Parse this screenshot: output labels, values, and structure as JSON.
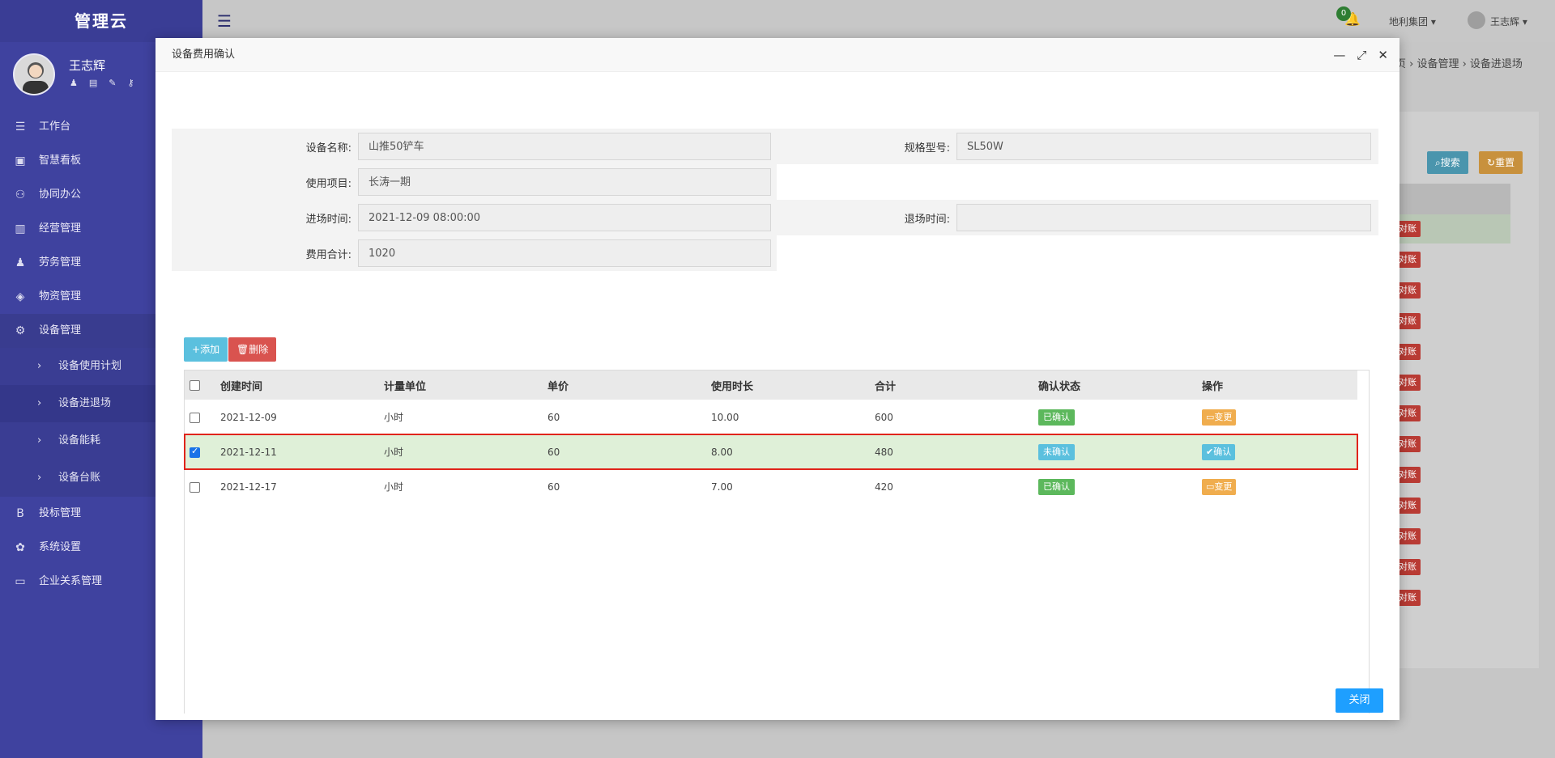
{
  "sidebar": {
    "brand": "管理云",
    "user_name": "王志辉",
    "menu": [
      {
        "label": "工作台",
        "icon": "☰"
      },
      {
        "label": "智慧看板",
        "icon": "▣"
      },
      {
        "label": "协同办公",
        "icon": "⚇"
      },
      {
        "label": "经营管理",
        "icon": "▥"
      },
      {
        "label": "劳务管理",
        "icon": "♟"
      },
      {
        "label": "物资管理",
        "icon": "◈"
      },
      {
        "label": "设备管理",
        "icon": "⚙"
      }
    ],
    "sub_menu": [
      {
        "label": "设备使用计划"
      },
      {
        "label": "设备进退场"
      },
      {
        "label": "设备能耗"
      },
      {
        "label": "设备台账"
      }
    ],
    "menu_after": [
      {
        "label": "投标管理",
        "icon": "B"
      },
      {
        "label": "系统设置",
        "icon": "✿"
      },
      {
        "label": "企业关系管理",
        "icon": "▭"
      }
    ]
  },
  "topbar": {
    "notification_count": "0",
    "company": "地利集团",
    "user": "王志辉"
  },
  "background": {
    "breadcrumb": "页 › 设备管理 › 设备进退场",
    "search_label": "搜索",
    "reset_label": "重置",
    "tag_label": "对账"
  },
  "modal": {
    "title": "设备费用确认",
    "form": {
      "name_label": "设备名称:",
      "name_value": "山推50铲车",
      "spec_label": "规格型号:",
      "spec_value": "SL50W",
      "project_label": "使用项目:",
      "project_value": "长涛一期",
      "enter_label": "进场时间:",
      "enter_value": "2021-12-09 08:00:00",
      "exit_label": "退场时间:",
      "exit_value": "",
      "total_label": "费用合计:",
      "total_value": "1020"
    },
    "add_label": "添加",
    "delete_label": "删除",
    "table": {
      "headers": [
        "创建时间",
        "计量单位",
        "单价",
        "使用时长",
        "合计",
        "确认状态",
        "操作"
      ],
      "rows": [
        {
          "date": "2021-12-09",
          "unit": "小时",
          "price": "60",
          "hours": "10.00",
          "total": "600",
          "status": "已确认",
          "status_type": "ok",
          "action": "变更",
          "action_type": "change",
          "checked": false
        },
        {
          "date": "2021-12-11",
          "unit": "小时",
          "price": "60",
          "hours": "8.00",
          "total": "480",
          "status": "未确认",
          "status_type": "pending",
          "action": "确认",
          "action_type": "confirm",
          "checked": true
        },
        {
          "date": "2021-12-17",
          "unit": "小时",
          "price": "60",
          "hours": "7.00",
          "total": "420",
          "status": "已确认",
          "status_type": "ok",
          "action": "变更",
          "action_type": "change",
          "checked": false
        }
      ]
    },
    "close_label": "关闭"
  }
}
